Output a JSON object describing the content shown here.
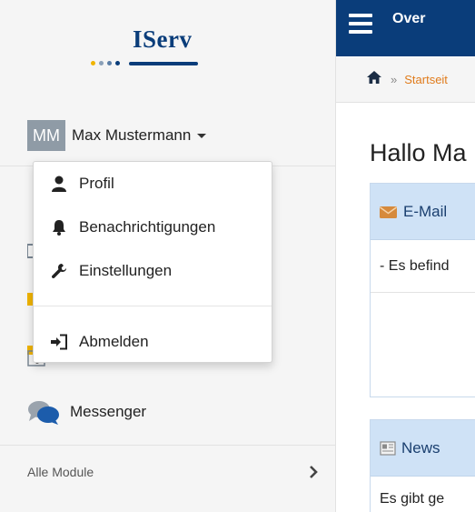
{
  "logo": {
    "text": "IServ"
  },
  "user": {
    "initials": "MM",
    "name": "Max Mustermann"
  },
  "dropdown": {
    "items": [
      {
        "label": "Profil",
        "icon": "user-icon"
      },
      {
        "label": "Benachrichtigungen",
        "icon": "bell-icon"
      },
      {
        "label": "Einstellungen",
        "icon": "wrench-icon"
      },
      {
        "label": "Abmelden",
        "icon": "sign-out-icon"
      }
    ]
  },
  "sidebar": {
    "messenger_label": "Messenger",
    "all_modules_label": "Alle Module"
  },
  "topbar": {
    "title": "Over"
  },
  "breadcrumb": {
    "separator": "»",
    "current": "Startseit"
  },
  "main": {
    "greeting": "Hallo Ma",
    "email_panel": {
      "title": "E-Mail",
      "body": "- Es befind"
    },
    "news_panel": {
      "title": "News",
      "body": "Es gibt ge"
    }
  },
  "colors": {
    "brand": "#0a3d7a",
    "accent": "#e07b1b",
    "panel_header": "#cfe2f6"
  }
}
